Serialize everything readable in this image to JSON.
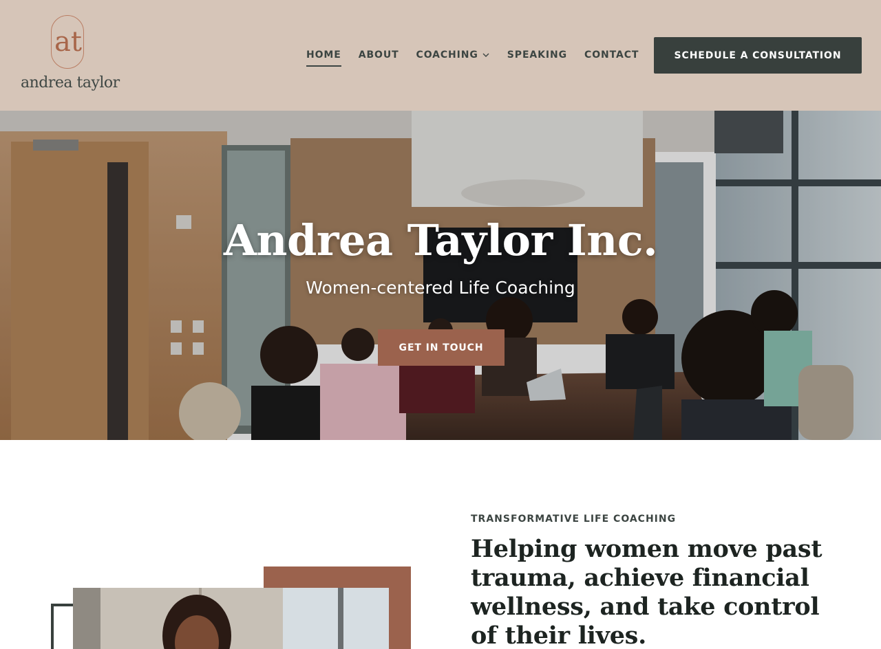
{
  "brand": {
    "logo_letters": "at",
    "name": "andrea taylor"
  },
  "nav": {
    "items": [
      {
        "label": "HOME",
        "active": true
      },
      {
        "label": "ABOUT",
        "active": false
      },
      {
        "label": "COACHING",
        "active": false,
        "has_dropdown": true
      },
      {
        "label": "SPEAKING",
        "active": false
      },
      {
        "label": "CONTACT",
        "active": false
      }
    ],
    "cta_label": "SCHEDULE A CONSULTATION"
  },
  "hero": {
    "title": "Andrea Taylor Inc.",
    "subtitle": "Women-centered Life Coaching",
    "button_label": "GET IN TOUCH"
  },
  "about": {
    "eyebrow": "TRANSFORMATIVE LIFE COACHING",
    "headline": "Helping women move past trauma, achieve financial wellness, and take control of their lives."
  },
  "colors": {
    "header_bg": "#d6c5b8",
    "dark_button": "#38403d",
    "accent": "#9b624d",
    "text_dark": "#1d2421"
  },
  "icons": {
    "dropdown": "chevron-down-icon"
  }
}
